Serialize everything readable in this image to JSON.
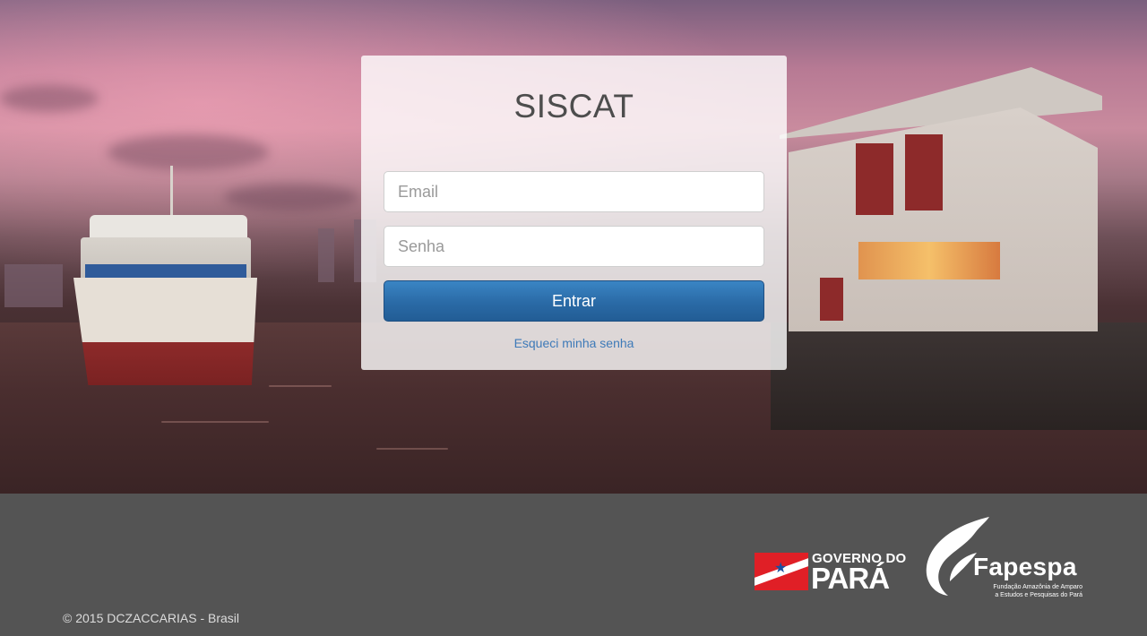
{
  "login": {
    "title": "SISCAT",
    "email_placeholder": "Email",
    "password_placeholder": "Senha",
    "submit_label": "Entrar",
    "forgot_link": "Esqueci minha senha"
  },
  "footer": {
    "copyright": "© 2015 DCZACCARIAS - Brasil",
    "logos": {
      "governo_top": "GOVERNO DO",
      "governo_main": "PARÁ",
      "fapespa_name": "Fapespa",
      "fapespa_sub_line1": "Fundação Amazônia de Amparo",
      "fapespa_sub_line2": "a Estudos e Pesquisas do Pará"
    }
  },
  "colors": {
    "button": "#2a6aa6",
    "link": "#3e7ab8",
    "footer_bg": "#545454",
    "flag_red": "#e01f26"
  }
}
